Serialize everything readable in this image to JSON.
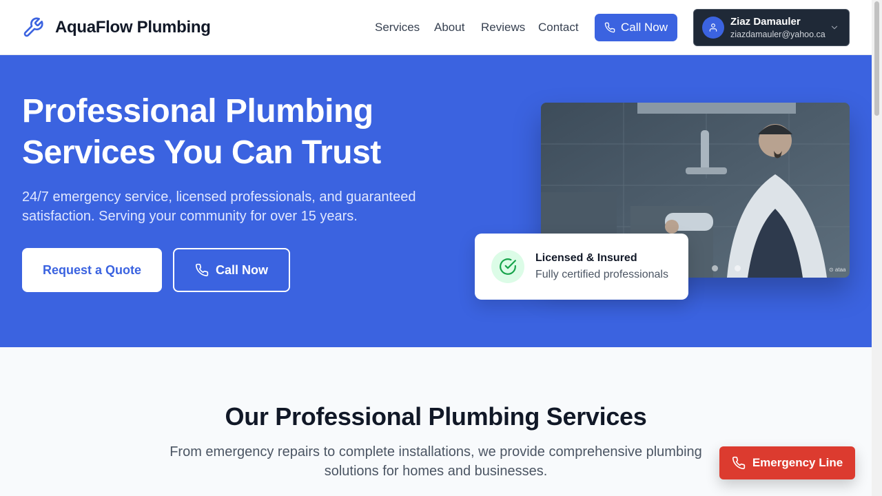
{
  "header": {
    "brand": "AquaFlow Plumbing",
    "nav": [
      "Services",
      "About",
      "Reviews",
      "Contact"
    ],
    "call_label": "Call Now",
    "user": {
      "name": "Ziaz Damauler",
      "email": "ziazdamauler@yahoo.ca"
    }
  },
  "hero": {
    "title": "Professional Plumbing Services You Can Trust",
    "subtitle": "24/7 emergency service, licensed professionals, and guaranteed satisfaction. Serving your community for over 15 years.",
    "quote_label": "Request a Quote",
    "call_label": "Call Now",
    "badge": {
      "title": "Licensed & Insured",
      "subtitle": "Fully certified professionals"
    },
    "image_watermark": "⊙ ataa"
  },
  "services": {
    "title": "Our Professional Plumbing Services",
    "subtitle": "From emergency repairs to complete installations, we provide comprehensive plumbing solutions for homes and businesses."
  },
  "emergency_label": "Emergency Line",
  "colors": {
    "primary": "#3b63e0",
    "emergency": "#dc3b2f",
    "dark": "#1f2937"
  },
  "icons": [
    "wrench-icon",
    "phone-icon",
    "user-icon",
    "chevron-down-icon",
    "check-circle-icon"
  ]
}
